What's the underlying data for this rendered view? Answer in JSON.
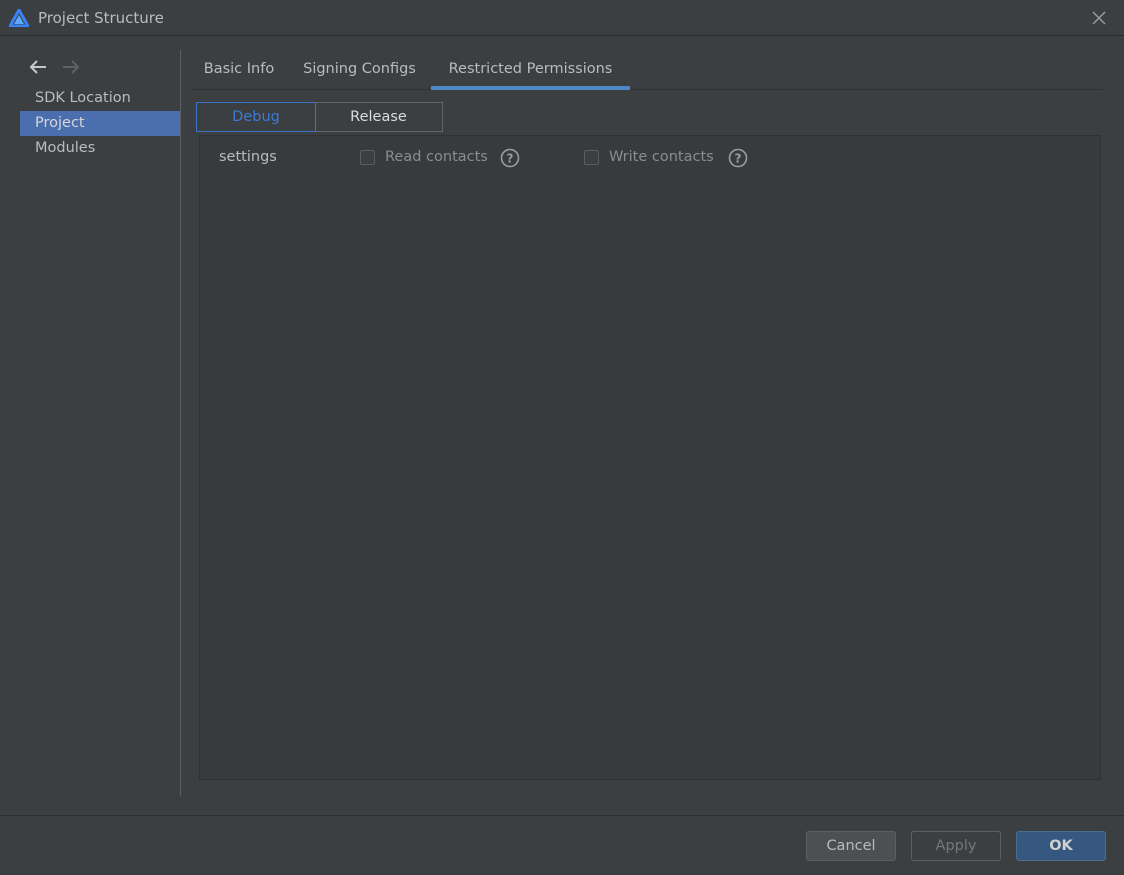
{
  "window": {
    "title": "Project Structure",
    "close_icon": "close-icon",
    "logo_icon": "app-logo-icon"
  },
  "sidebar": {
    "back_icon": "arrow-left-icon",
    "forward_icon": "arrow-right-icon",
    "items": [
      {
        "label": "SDK Location",
        "selected": false
      },
      {
        "label": "Project",
        "selected": true
      },
      {
        "label": "Modules",
        "selected": false
      }
    ]
  },
  "tabs": [
    {
      "label": "Basic Info",
      "active": false
    },
    {
      "label": "Signing Configs",
      "active": false
    },
    {
      "label": "Restricted Permissions",
      "active": true
    }
  ],
  "segments": {
    "debug_label": "Debug",
    "release_label": "Release",
    "selected": "Debug"
  },
  "permissions": {
    "module_label": "settings",
    "read_label": "Read contacts",
    "read_checked": false,
    "write_label": "Write contacts",
    "write_checked": false,
    "help_icon": "question-circle-icon"
  },
  "footer": {
    "cancel_label": "Cancel",
    "apply_label": "Apply",
    "ok_label": "OK"
  },
  "colors": {
    "background": "#3c3f41",
    "selection": "#4b6eaf",
    "tab_underline": "#4a88c7",
    "debug_accent": "#3d7ad6",
    "ok_button": "#365880"
  }
}
